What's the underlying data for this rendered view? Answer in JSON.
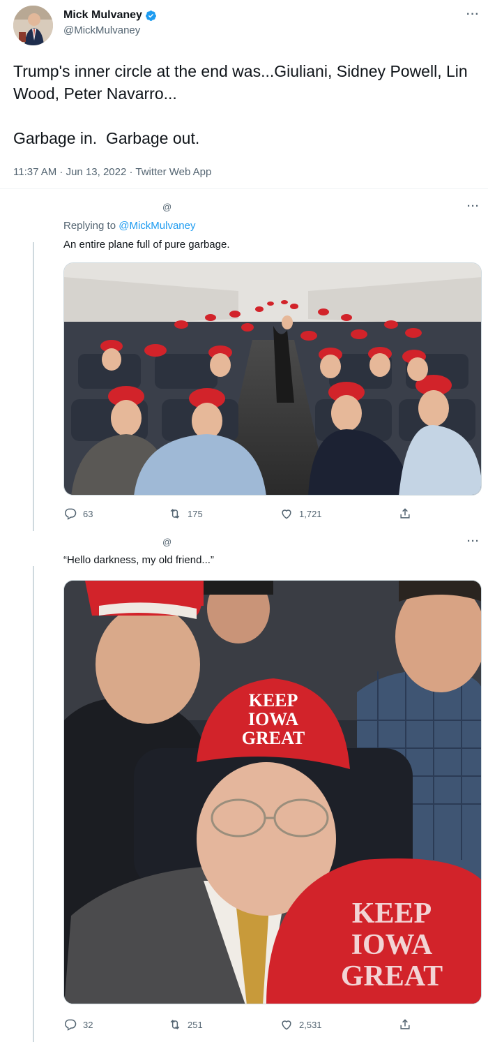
{
  "main_tweet": {
    "display_name": "Mick Mulvaney",
    "handle": "@MickMulvaney",
    "text": "Trump's inner circle at the end was...Giuliani, Sidney Powell, Lin Wood, Peter Navarro...\n\nGarbage in.  Garbage out.",
    "meta": "11:37 AM · Jun 13, 2022 · Twitter Web App",
    "more_label": "···"
  },
  "replies": [
    {
      "at_label": "@",
      "more_label": "···",
      "replying_prefix": "Replying to ",
      "replying_mention": "@MickMulvaney",
      "text": "An entire plane full of pure garbage.",
      "replies_count": "63",
      "retweets_count": "175",
      "likes_count": "1,721"
    },
    {
      "at_label": "@",
      "more_label": "···",
      "text": "“Hello darkness, my old friend...”",
      "replies_count": "32",
      "retweets_count": "251",
      "likes_count": "2,531"
    }
  ],
  "hat_text": {
    "line1": "KEEP",
    "line2": "IOWA",
    "line3": "GREAT"
  },
  "colors": {
    "accent": "#1d9bf0",
    "secondary_text": "#536471",
    "hat_red": "#d2232a"
  }
}
